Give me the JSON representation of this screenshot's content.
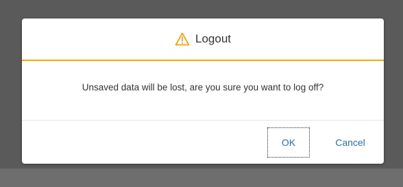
{
  "dialog": {
    "title": "Logout",
    "title_icon": "warning-icon",
    "message": "Unsaved data will be lost, are you sure you want to log off?",
    "buttons": {
      "ok_label": "OK",
      "cancel_label": "Cancel"
    }
  },
  "colors": {
    "accent": "#f0ab00",
    "button_text": "#2a6ea8",
    "overlay": "#5a5a5a"
  }
}
